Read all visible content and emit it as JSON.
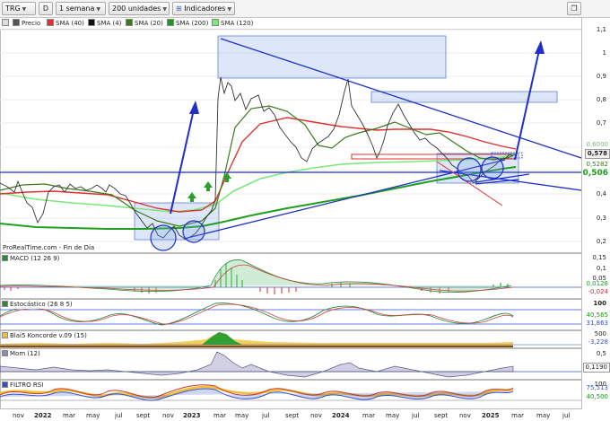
{
  "toolbar": {
    "symbol": "TRG",
    "d_icon": "D",
    "period": "1 semana",
    "units": "200 unidades",
    "indicators": "Indicadores",
    "right_icon": "window-restore-icon"
  },
  "legend": {
    "items": [
      {
        "label": "Precio",
        "color": "#555555"
      },
      {
        "label": "SMA (40)",
        "color": "#e03030"
      },
      {
        "label": "SMA (4)",
        "color": "#111111"
      },
      {
        "label": "SMA (20)",
        "color": "#3a7a1a"
      },
      {
        "label": "SMA (200)",
        "color": "#1f9a1f"
      },
      {
        "label": "SMA (120)",
        "color": "#7be87b"
      }
    ]
  },
  "source_text": "ProRealTime.com - Fin de Día",
  "colors": {
    "price": "#333333",
    "trendline": "#1f2fc8",
    "box_fill": "rgba(120,160,230,0.25)",
    "box_stroke": "#4a74c8",
    "sma40": "#e03030",
    "sma20": "#3a7a1a",
    "sma200": "#1fa01f",
    "sma120": "#7be87b",
    "highlight_red_box": "#e03030"
  },
  "price_panel": {
    "yticks": [
      "1,1",
      "1",
      "0,9",
      "0,8",
      "0,7",
      "0,6",
      "0,5",
      "0,4",
      "0,3",
      "0,2"
    ],
    "tags": [
      {
        "text": "0,6000",
        "color": "#7bb87b",
        "bg": "#ffffff"
      },
      {
        "text": "0,578",
        "color": "#000000",
        "bg": "#f0f0f0"
      },
      {
        "text": "0,5282",
        "color": "#3a7a1a",
        "bg": "#ffffff"
      },
      {
        "text": "0,506",
        "color": "#1a9a1a",
        "bg": "#ffffff"
      }
    ]
  },
  "indicators": [
    {
      "name": "MACD (12 26 9)",
      "yticks": [
        "0,15",
        "0,1",
        "0,05",
        "0"
      ],
      "tags": [
        {
          "text": "0,0128",
          "color": "#1a9a1a"
        },
        {
          "text": "-0,024",
          "color": "#d03030"
        }
      ]
    },
    {
      "name": "Estocástico (26 8 5)",
      "yticks": [
        "100",
        "50",
        "0"
      ],
      "tags": [
        {
          "text": "40,565",
          "color": "#1a9a1a"
        },
        {
          "text": "31,863",
          "color": "#3050d0"
        }
      ]
    },
    {
      "name": "Blai5 Koncorde v.09 (15)",
      "yticks": [
        "500",
        "0"
      ],
      "tags": [
        {
          "text": "-3,228",
          "color": "#3050d0"
        }
      ]
    },
    {
      "name": "Mom (12)",
      "yticks": [
        "0,5"
      ],
      "tags": [
        {
          "text": "0,1190",
          "color": "#000000"
        }
      ]
    },
    {
      "name": "FILTRO RSI",
      "yticks": [
        "100"
      ],
      "tags": [
        {
          "text": "75,513",
          "color": "#3050d0"
        },
        {
          "text": "40,500",
          "color": "#1a9a1a"
        }
      ]
    }
  ],
  "xaxis": {
    "labels": [
      {
        "text": "nov",
        "year": false
      },
      {
        "text": "2022",
        "year": true
      },
      {
        "text": "mar",
        "year": false
      },
      {
        "text": "may",
        "year": false
      },
      {
        "text": "jul",
        "year": false
      },
      {
        "text": "sept",
        "year": false
      },
      {
        "text": "nov",
        "year": false
      },
      {
        "text": "2023",
        "year": true
      },
      {
        "text": "mar",
        "year": false
      },
      {
        "text": "may",
        "year": false
      },
      {
        "text": "jul",
        "year": false
      },
      {
        "text": "sept",
        "year": false
      },
      {
        "text": "nov",
        "year": false
      },
      {
        "text": "2024",
        "year": true
      },
      {
        "text": "mar",
        "year": false
      },
      {
        "text": "may",
        "year": false
      },
      {
        "text": "jul",
        "year": false
      },
      {
        "text": "sept",
        "year": false
      },
      {
        "text": "nov",
        "year": false
      },
      {
        "text": "2025",
        "year": true
      },
      {
        "text": "mar",
        "year": false
      },
      {
        "text": "may",
        "year": false
      },
      {
        "text": "jul",
        "year": false
      }
    ]
  }
}
